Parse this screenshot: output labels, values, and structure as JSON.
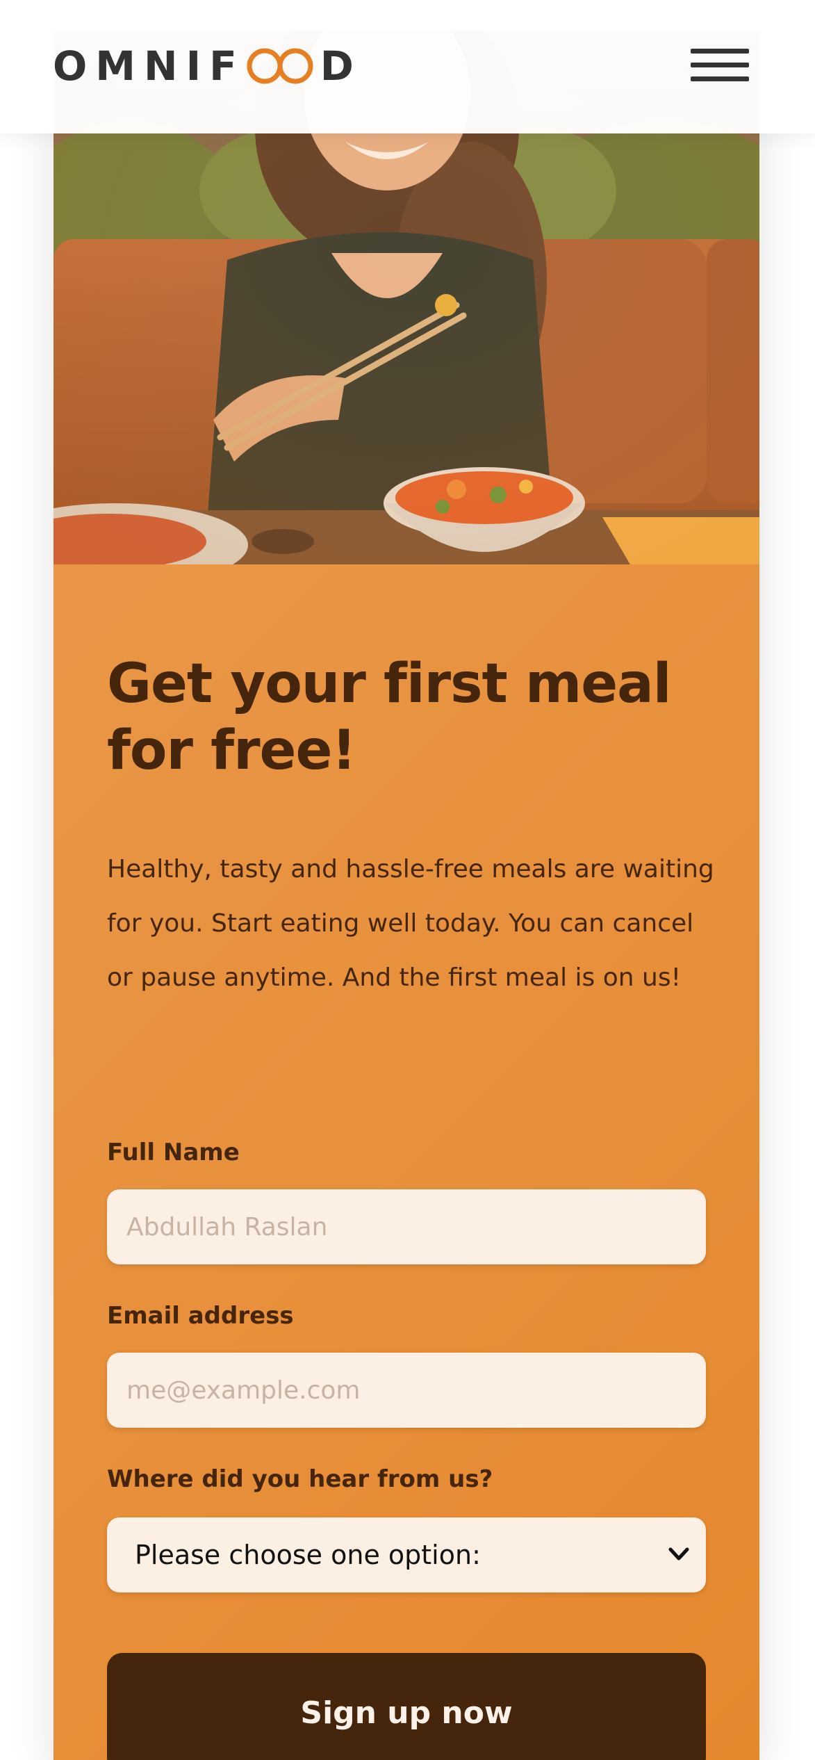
{
  "header": {
    "logo_text_left": "OMNIF",
    "logo_text_right": "D",
    "logo_mark": "infinity-loop-icon",
    "menu_icon": "hamburger-menu-icon"
  },
  "cta": {
    "image_alt": "Woman enjoying food meals in a bowl",
    "title": "Get your first meal for free!",
    "text": "Healthy, tasty and hassle-free meals are waiting for you. Start eating well today. You can cancel or pause anytime. And the first meal is on us!",
    "form": {
      "full_name_label": "Full Name",
      "full_name_placeholder": "Abdullah Raslan",
      "email_label": "Email address",
      "email_placeholder": "me@example.com",
      "select_label": "Where did you hear from us?",
      "select_value": "Please choose one option:",
      "submit_label": "Sign up now"
    }
  },
  "colors": {
    "brand": "#e67e22",
    "dark_brown": "#45250b",
    "field_bg": "#fcefe4"
  }
}
